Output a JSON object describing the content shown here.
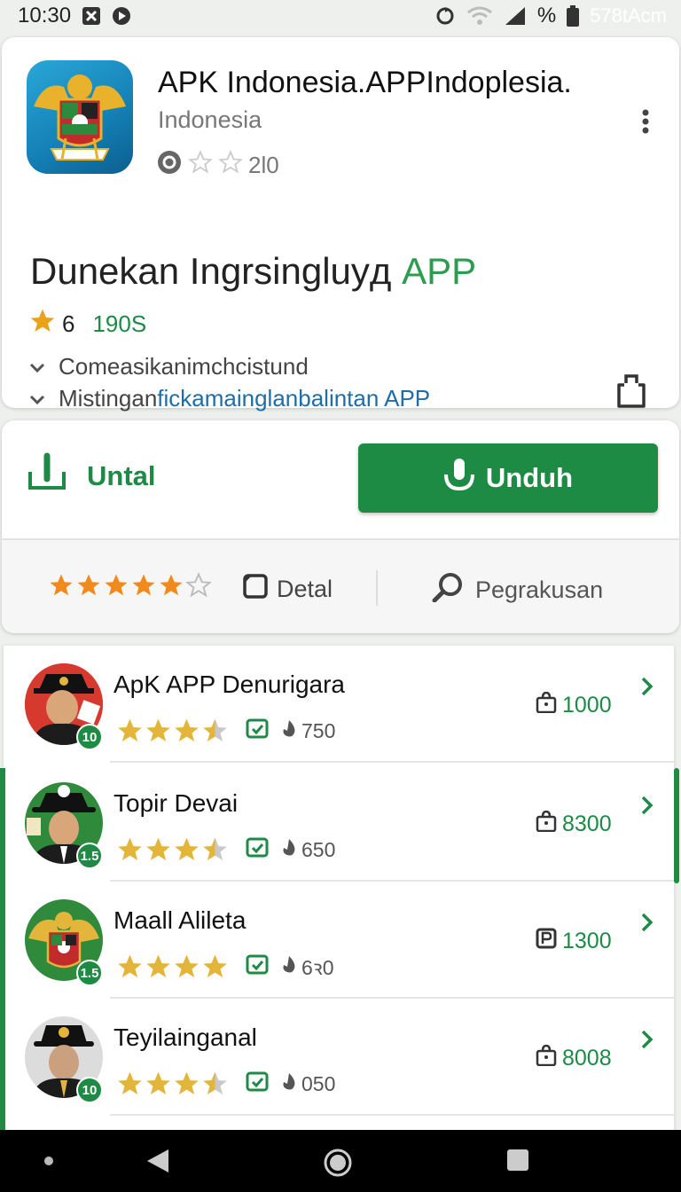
{
  "status_bar": {
    "time": "10:30",
    "battery": "%",
    "extra": "578tAcm"
  },
  "app": {
    "title": "APK Indonesia.APPIndoplesia.",
    "subtitle": "Indonesia",
    "small_rating_count": "2l0",
    "headline_main": "Dunekan Ingrsingluyд",
    "headline_accent": "APP",
    "rating_value": "6",
    "rating_count": "190S",
    "feature_1": "Comeasikanimchcistund",
    "feature_2_prefix": "Mistingan",
    "feature_2_link": "fickamainglanbalintan APP"
  },
  "actions": {
    "untal_label": "Untal",
    "unduh_label": "Unduh",
    "stars_filled": 5,
    "detal_label": "Detal",
    "pegrakusan_label": "Pegrakusan"
  },
  "list": [
    {
      "name": "ApK APP Denurigara",
      "badge": "10",
      "reviews": "750",
      "count": "1000",
      "stars": 3.5
    },
    {
      "name": "Topir Devai",
      "badge": "1.5",
      "reviews": "650",
      "count": "8300",
      "stars": 3.5
    },
    {
      "name": "Maall Alileta",
      "badge": "1.5",
      "reviews": "6ꝛ0",
      "count": "1300",
      "stars": 4
    },
    {
      "name": "Teyilainganal",
      "badge": "10",
      "reviews": "050",
      "count": "8008",
      "stars": 3.5
    }
  ],
  "colors": {
    "accent_green": "#1e8b45",
    "link_blue": "#1f6da8",
    "star_orange": "#f08a1c",
    "star_gold": "#e3b53a"
  }
}
